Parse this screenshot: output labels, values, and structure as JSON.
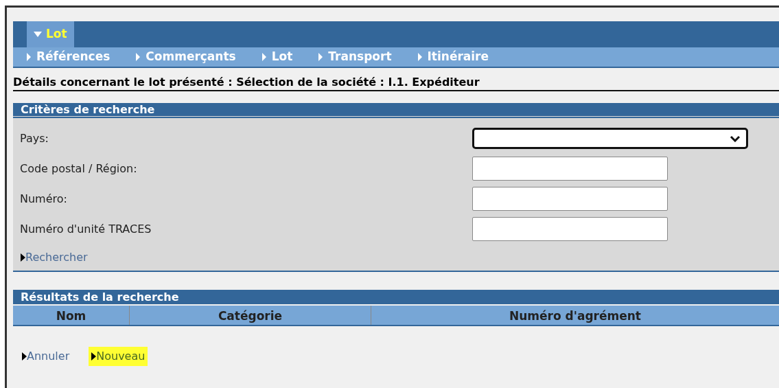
{
  "top_tabs": [
    {
      "label": "Lot",
      "selected": true,
      "expanded": true
    }
  ],
  "subnav": [
    "Références",
    "Commerçants",
    "Lot",
    "Transport",
    "Itinéraire"
  ],
  "page_heading": "Détails concernant le lot présenté : Sélection de la société : I.1. Expéditeur",
  "search_criteria": {
    "title": "Critères de recherche",
    "fields": [
      {
        "label": "Pays:",
        "kind": "select"
      },
      {
        "label": "Code postal / Région:",
        "kind": "text"
      },
      {
        "label": "Numéro:",
        "kind": "text"
      },
      {
        "label": "Numéro d'unité TRACES",
        "kind": "text"
      }
    ],
    "search_link": "Rechercher"
  },
  "results": {
    "title": "Résultats de la recherche",
    "columns": [
      "Nom",
      "Catégorie",
      "Numéro d'agrément"
    ]
  },
  "actions": [
    {
      "label": "Annuler",
      "highlighted": false
    },
    {
      "label": "Nouveau",
      "highlighted": true
    }
  ]
}
